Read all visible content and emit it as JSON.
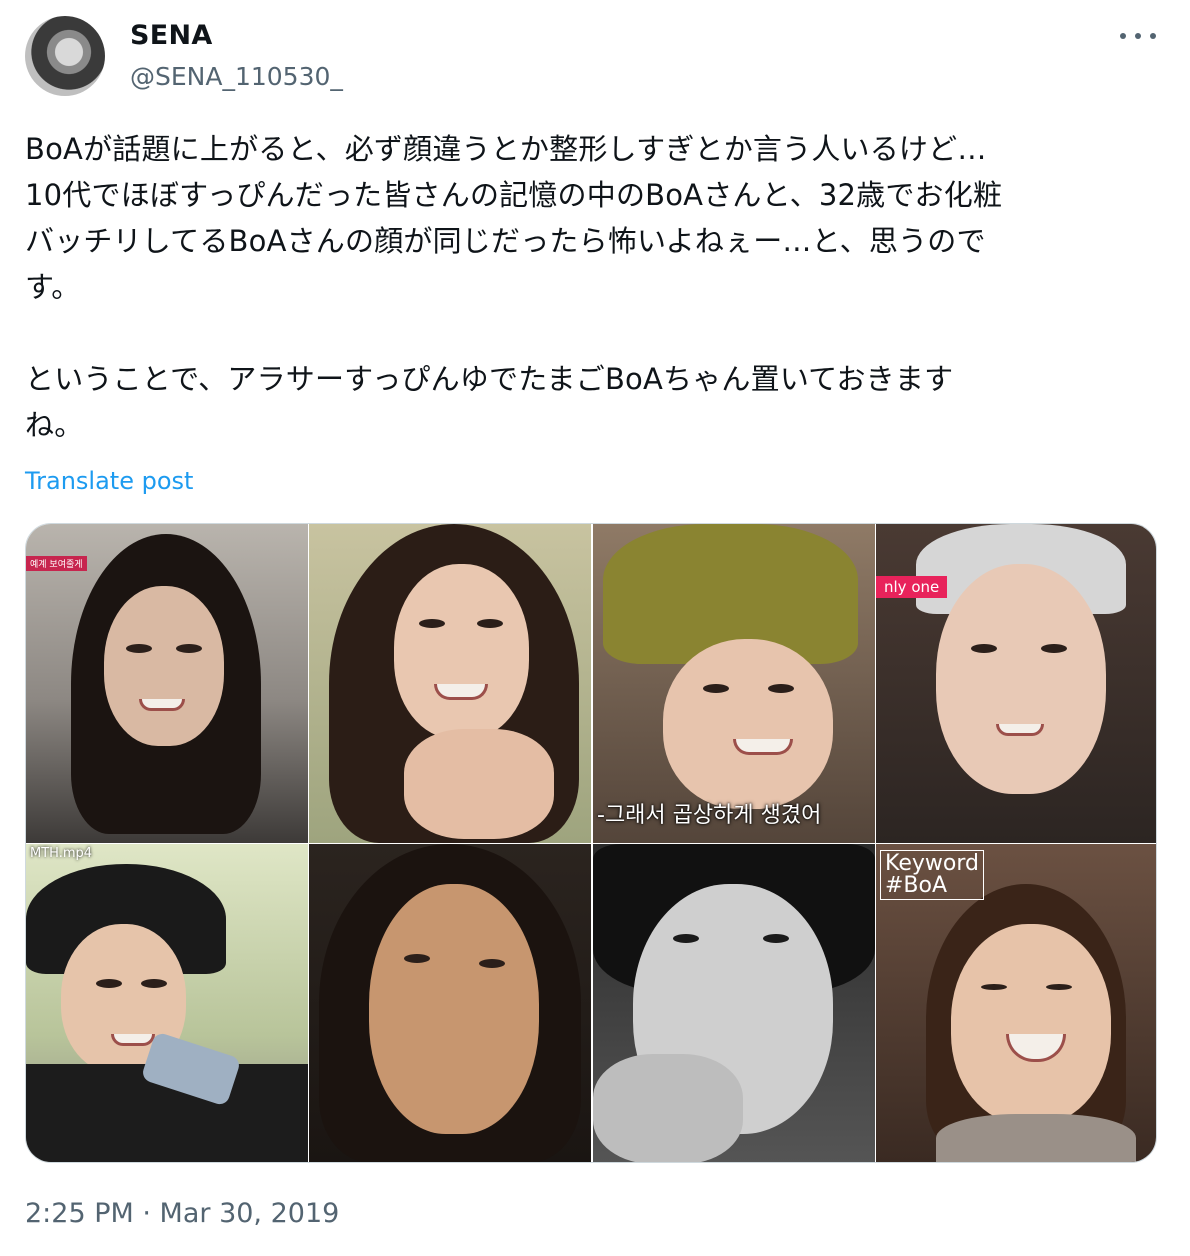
{
  "author": {
    "name": "SENA",
    "handle": "@SENA_110530_",
    "avatar_icon": "profile-photo-avatar"
  },
  "tweet": {
    "text_lines": [
      "BoAが話題に上がると、必ず顔違うとか整形しすぎとか言う人いるけど…",
      "10代でほぼすっぴんだった皆さんの記憶の中のBoAさんと、32歳でお化粧",
      "バッチリしてるBoAさんの顔が同じだったら怖いよねぇー…と、思うので",
      "す。",
      "",
      "ということで、アラサーすっぴんゆでたまごBoAちゃん置いておきます",
      "ね。"
    ],
    "translate_label": "Translate post",
    "timestamp": "2:25 PM · Mar 30, 2019"
  },
  "media": {
    "left_image": {
      "captions": {
        "tl_tag": "예계 보여줄게",
        "bl_file": "MTH.mp4"
      }
    },
    "right_image": {
      "captions": {
        "tl_subtitle": "-그래서 곱상하게 생겼어",
        "tr_tag": "nly one",
        "br_keyword_top": "Keyword",
        "br_keyword_bottom": "#BoA"
      }
    }
  },
  "colors": {
    "accent": "#1d9bf0",
    "secondary_text": "#536471",
    "primary_text": "#0f1419",
    "border": "#cfd9de"
  }
}
